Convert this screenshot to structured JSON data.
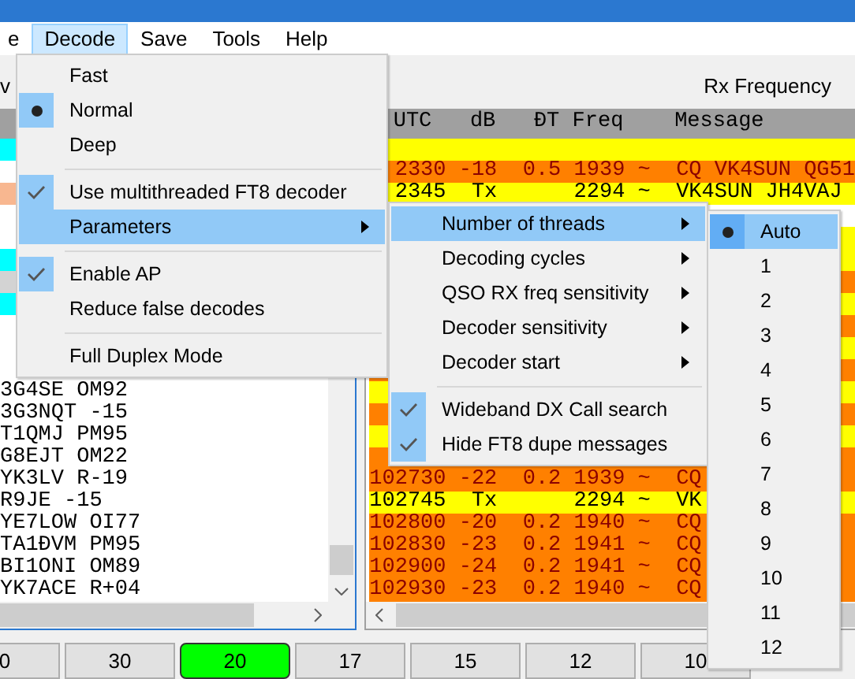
{
  "menubar": [
    {
      "label": "e",
      "selected": false
    },
    {
      "label": "Decode",
      "selected": true
    },
    {
      "label": "Save",
      "selected": false
    },
    {
      "label": "Tools",
      "selected": false
    },
    {
      "label": "Help",
      "selected": false
    }
  ],
  "left_panel": {
    "title": "v",
    "rows": [
      {
        "color": "#00ffff"
      },
      {},
      {
        "color": "#f8b790"
      },
      {},
      {},
      {
        "color": "#00ffff"
      },
      {
        "color": "#d3d3d3"
      },
      {
        "color": "#00ffff"
      },
      {},
      {},
      {},
      {
        "text": "3G4SE OM92"
      },
      {
        "text": "3G3NQT -15"
      },
      {
        "text": "T1QMJ PM95"
      },
      {
        "text": "G8EJT OM22"
      },
      {
        "text": "YK3LV R-19"
      },
      {
        "text": "R9JE -15"
      },
      {
        "text": "YE7LOW OI77"
      },
      {
        "text": "TA1ĐVM PM95"
      },
      {
        "text": "BI1ONI OM89"
      },
      {
        "text": "YK7ACE R+04"
      }
    ]
  },
  "right_panel": {
    "label": "Rx Frequency",
    "header": "  UTC   dB   ĐT Freq    Message",
    "rows": [
      {
        "kind": "tx"
      },
      {
        "kind": "cq",
        "text": "  2330 -18  0.5 1939 ~  CQ VK4SUN QG51"
      },
      {
        "kind": "tx",
        "text": "  2345  Tx      2294 ~  VK4SUN JH4VAJ"
      },
      {
        "kind": "plain"
      },
      {
        "kind": "tx"
      },
      {
        "kind": "tx"
      },
      {
        "kind": "cq"
      },
      {
        "kind": "tx"
      },
      {
        "kind": "cq"
      },
      {
        "kind": "tx"
      },
      {
        "kind": "cq"
      },
      {
        "kind": "tx"
      },
      {
        "kind": "cq"
      },
      {
        "kind": "tx"
      },
      {
        "kind": "cq"
      },
      {
        "kind": "cq",
        "text": "102730 -22  0.2 1939 ~  CQ"
      },
      {
        "kind": "tx",
        "text": "102745  Tx      2294 ~  VK"
      },
      {
        "kind": "cq",
        "text": "102800 -20  0.2 1940 ~  CQ"
      },
      {
        "kind": "cq",
        "text": "102830 -23  0.2 1941 ~  CQ"
      },
      {
        "kind": "cq",
        "text": "102900 -24  0.2 1941 ~  CQ"
      },
      {
        "kind": "cq",
        "text": "102930 -23  0.2 1940 ~  CQ"
      }
    ]
  },
  "band_buttons": [
    {
      "label": "0",
      "selected": false
    },
    {
      "label": "30",
      "selected": false
    },
    {
      "label": "20",
      "selected": true
    },
    {
      "label": "17",
      "selected": false
    },
    {
      "label": "15",
      "selected": false
    },
    {
      "label": "12",
      "selected": false
    },
    {
      "label": "10",
      "selected": false
    }
  ],
  "decode_menu": {
    "items": [
      {
        "kind": "radio",
        "label": "Fast",
        "checked": false,
        "selected": false
      },
      {
        "kind": "radio",
        "label": "Normal",
        "checked": true,
        "selected": false
      },
      {
        "kind": "radio",
        "label": "Deep",
        "checked": false,
        "selected": false
      },
      {
        "kind": "separator"
      },
      {
        "kind": "check",
        "label": "Use multithreaded FT8 decoder",
        "checked": true,
        "selected": false
      },
      {
        "kind": "submenu",
        "label": "Parameters",
        "selected": true
      },
      {
        "kind": "separator"
      },
      {
        "kind": "check",
        "label": "Enable AP",
        "checked": true,
        "selected": false
      },
      {
        "kind": "check",
        "label": "Reduce false decodes",
        "checked": false,
        "selected": false
      },
      {
        "kind": "separator"
      },
      {
        "kind": "check",
        "label": "Full Duplex Mode",
        "checked": false,
        "selected": false
      }
    ]
  },
  "parameters_menu": {
    "items": [
      {
        "kind": "submenu",
        "label": "Number of threads",
        "selected": true
      },
      {
        "kind": "submenu",
        "label": "Decoding cycles",
        "selected": false
      },
      {
        "kind": "submenu",
        "label": "QSO RX freq sensitivity",
        "selected": false
      },
      {
        "kind": "submenu",
        "label": "Decoder sensitivity",
        "selected": false
      },
      {
        "kind": "submenu",
        "label": "Decoder start",
        "selected": false
      },
      {
        "kind": "separator"
      },
      {
        "kind": "check",
        "label": "Wideband DX Call search",
        "checked": true,
        "selected": false
      },
      {
        "kind": "check",
        "label": "Hide FT8 dupe messages",
        "checked": true,
        "selected": false
      }
    ]
  },
  "threads_menu": {
    "items": [
      {
        "kind": "radio",
        "label": "Auto",
        "checked": true,
        "selected": true
      },
      {
        "kind": "radio",
        "label": "1",
        "checked": false,
        "selected": false
      },
      {
        "kind": "radio",
        "label": "2",
        "checked": false,
        "selected": false
      },
      {
        "kind": "radio",
        "label": "3",
        "checked": false,
        "selected": false
      },
      {
        "kind": "radio",
        "label": "4",
        "checked": false,
        "selected": false
      },
      {
        "kind": "radio",
        "label": "5",
        "checked": false,
        "selected": false
      },
      {
        "kind": "radio",
        "label": "6",
        "checked": false,
        "selected": false
      },
      {
        "kind": "radio",
        "label": "7",
        "checked": false,
        "selected": false
      },
      {
        "kind": "radio",
        "label": "8",
        "checked": false,
        "selected": false
      },
      {
        "kind": "radio",
        "label": "9",
        "checked": false,
        "selected": false
      },
      {
        "kind": "radio",
        "label": "10",
        "checked": false,
        "selected": false
      },
      {
        "kind": "radio",
        "label": "11",
        "checked": false,
        "selected": false
      },
      {
        "kind": "radio",
        "label": "12",
        "checked": false,
        "selected": false
      }
    ]
  }
}
